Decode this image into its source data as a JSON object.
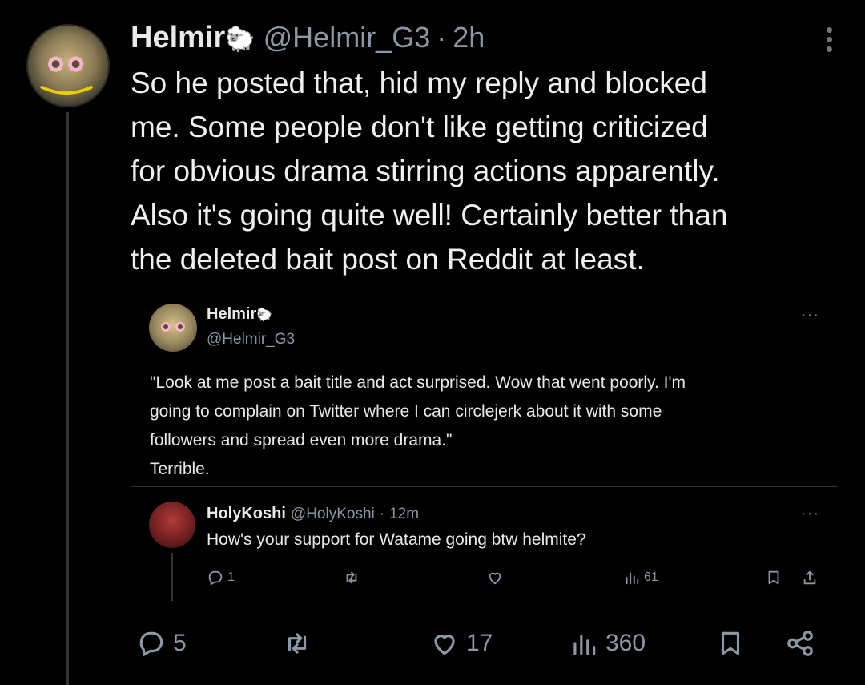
{
  "tweet": {
    "author_name": "Helmir",
    "author_emoji": "🐑",
    "handle": "@Helmir_G3",
    "separator": "·",
    "time": "2h",
    "text_lines": [
      "So he posted that, hid my reply and blocked",
      "me.  Some people don't like getting criticized",
      "for obvious drama stirring actions apparently.",
      "Also it's going quite well! Certainly better than",
      "the deleted bait post on Reddit at least."
    ],
    "stats": {
      "replies": "5",
      "retweets": "",
      "likes": "17",
      "views": "360"
    }
  },
  "quoted": {
    "author_name": "Helmir",
    "author_emoji": "🐑",
    "handle": "@Helmir_G3",
    "more": "···",
    "text_lines": [
      "\"Look at me post a bait title and act surprised. Wow that went poorly. I'm",
      "going to complain on Twitter where I can circlejerk about it with some",
      "followers and spread even more drama.\"",
      "Terrible."
    ]
  },
  "reply": {
    "author_name": "HolyKoshi",
    "handle": "@HolyKoshi",
    "separator": "·",
    "time": "12m",
    "more": "···",
    "text": "How's your support for Watame going btw helmite?",
    "stats": {
      "replies": "1",
      "views": "61"
    }
  },
  "icons": {
    "reply": "reply-icon",
    "retweet": "retweet-icon",
    "like": "heart-icon",
    "views": "views-icon",
    "bookmark": "bookmark-icon",
    "share": "share-icon"
  }
}
